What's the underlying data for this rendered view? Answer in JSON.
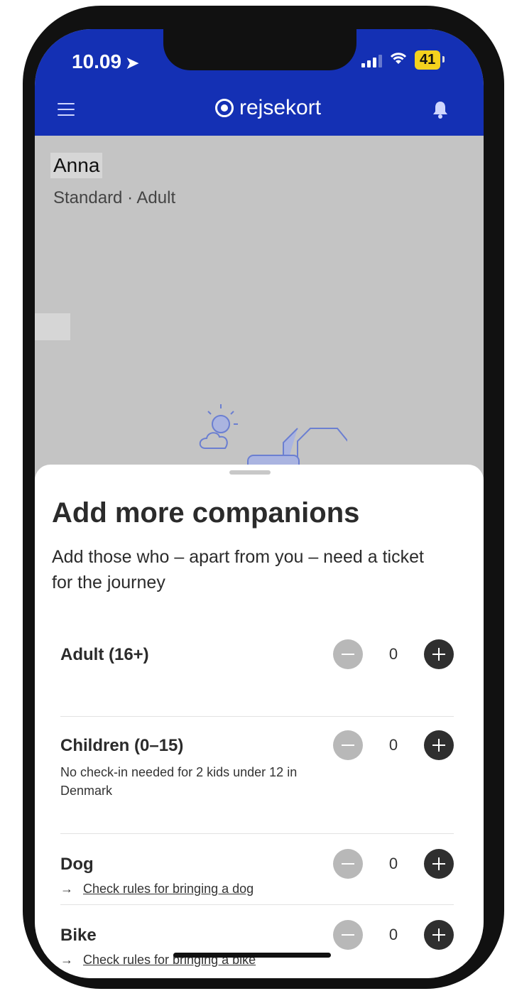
{
  "status_bar": {
    "time": "10.09",
    "battery": "41"
  },
  "header": {
    "brand": "rejsekort"
  },
  "profile": {
    "name": "Anna",
    "subtitle": "Standard · Adult"
  },
  "sheet": {
    "title": "Add more companions",
    "description": "Add those who – apart from you – need a ticket for the journey",
    "rows": [
      {
        "label": "Adult (16+)",
        "count": "0"
      },
      {
        "label": "Children (0–15)",
        "note": "No check-in needed for 2 kids under 12 in Denmark",
        "count": "0"
      },
      {
        "label": "Dog",
        "link_arrow": "→",
        "link": "Check rules for bringing a dog",
        "count": "0"
      },
      {
        "label": "Bike",
        "link_arrow": "→",
        "link": "Check rules for bringing a bike",
        "count": "0"
      }
    ]
  },
  "icons": [
    "location-arrow-icon",
    "signal-icon",
    "wifi-icon",
    "battery-icon",
    "menu-icon",
    "rejsekort-logo-icon",
    "bell-icon",
    "minus-icon",
    "plus-icon"
  ],
  "colors": {
    "header_bg": "#1430b4",
    "battery": "#f4d21e",
    "plus": "#2f2f2f",
    "minus_disabled": "#b8b8b8"
  }
}
